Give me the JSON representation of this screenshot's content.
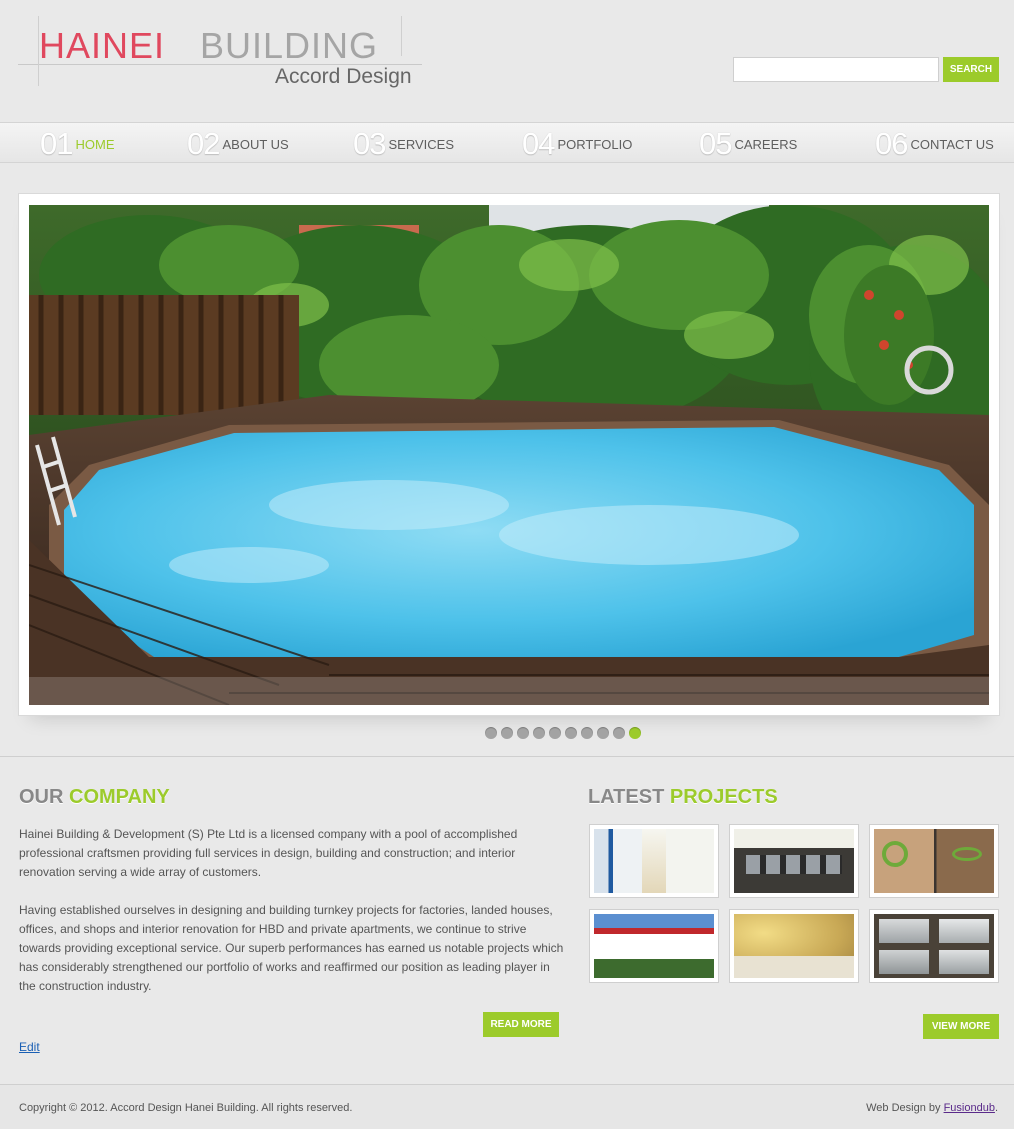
{
  "header": {
    "logo_part1": "HAINEI",
    "logo_part2": "BUILDING",
    "logo_sub": "Accord Design",
    "search_placeholder": "",
    "search_button": "SEARCH"
  },
  "nav": [
    {
      "num": "01",
      "label": "HOME",
      "active": true
    },
    {
      "num": "02",
      "label": "ABOUT US",
      "active": false
    },
    {
      "num": "03",
      "label": "SERVICES",
      "active": false
    },
    {
      "num": "04",
      "label": "PORTFOLIO",
      "active": false
    },
    {
      "num": "05",
      "label": "CAREERS",
      "active": false
    },
    {
      "num": "06",
      "label": "CONTACT US",
      "active": false
    }
  ],
  "slider": {
    "image": "swimming-pool-with-wooden-deck-and-tropical-plants",
    "slide_count": 10,
    "active_index": 9
  },
  "company": {
    "title_gray": "OUR",
    "title_green": "COMPANY",
    "paragraph1": "Hainei Building & Development (S) Pte Ltd is a licensed company with a pool of accomplished professional craftsmen providing full services in design, building and construction; and interior renovation serving a wide array of customers.",
    "paragraph2": "Having established ourselves in designing and building turnkey projects for factories, landed houses, offices, and shops and interior renovation for HBD and private apartments, we continue to strive towards providing exceptional service. Our superb performances has earned us notable projects which has considerably strengthened our portfolio of works and reaffirmed our position as leading player in the construction industry.",
    "read_more": "READ MORE",
    "edit": "Edit"
  },
  "projects": {
    "title_gray": "LATEST",
    "title_green": "PROJECTS",
    "thumbnails": [
      "glass-corridor",
      "open-office",
      "reception-logo",
      "building-exterior",
      "yellow-room",
      "glass-panels"
    ],
    "view_more": "VIEW MORE"
  },
  "footer": {
    "copyright": "Copyright © 2012. Accord Design Hanei Building. All rights reserved.",
    "credit_prefix": "Web Design by ",
    "credit_link": "Fusiondub",
    "credit_suffix": "."
  },
  "colors": {
    "accent": "#9ccb2b",
    "logo_red": "#e0485e",
    "background": "#e9e9e9"
  }
}
